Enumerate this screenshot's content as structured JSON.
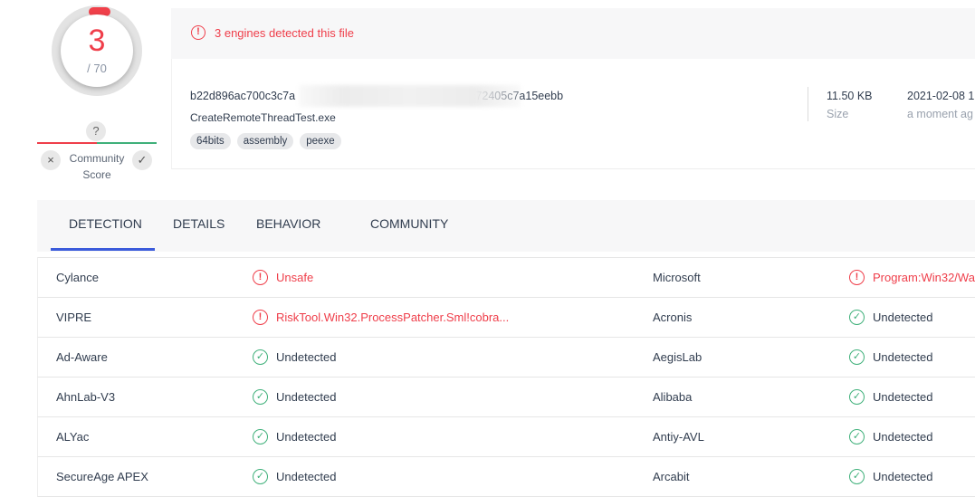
{
  "score": {
    "detected": "3",
    "total": "/ 70"
  },
  "community": {
    "question_icon": "?",
    "x_icon": "×",
    "check_icon": "✓",
    "label_line1": "Community",
    "label_line2": "Score"
  },
  "banner": {
    "icon": "!",
    "text": "3 engines detected this file"
  },
  "file": {
    "hash_visible": "b22d896ac700c3c7a                                        a0c08a9cc72405c7a15eebb",
    "name": "CreateRemoteThreadTest.exe",
    "tags": [
      "64bits",
      "assembly",
      "peexe"
    ],
    "size_value": "11.50 KB",
    "size_label": "Size",
    "date_value": "2021-02-08 1",
    "date_label": "a moment ag"
  },
  "tabs": [
    "DETECTION",
    "DETAILS",
    "BEHAVIOR",
    "COMMUNITY"
  ],
  "colors": {
    "malicious": "#ef3e4a",
    "clean": "#3fb07a",
    "accent": "#3b5bdb"
  },
  "detections": [
    {
      "left_engine": "Cylance",
      "left_result": "Unsafe",
      "left_status": "malicious",
      "right_engine": "Microsoft",
      "right_result": "Program:Win32/Wa",
      "right_status": "malicious"
    },
    {
      "left_engine": "VIPRE",
      "left_result": "RiskTool.Win32.ProcessPatcher.Sml!cobra...",
      "left_status": "malicious",
      "right_engine": "Acronis",
      "right_result": "Undetected",
      "right_status": "clean"
    },
    {
      "left_engine": "Ad-Aware",
      "left_result": "Undetected",
      "left_status": "clean",
      "right_engine": "AegisLab",
      "right_result": "Undetected",
      "right_status": "clean"
    },
    {
      "left_engine": "AhnLab-V3",
      "left_result": "Undetected",
      "left_status": "clean",
      "right_engine": "Alibaba",
      "right_result": "Undetected",
      "right_status": "clean"
    },
    {
      "left_engine": "ALYac",
      "left_result": "Undetected",
      "left_status": "clean",
      "right_engine": "Antiy-AVL",
      "right_result": "Undetected",
      "right_status": "clean"
    },
    {
      "left_engine": "SecureAge APEX",
      "left_result": "Undetected",
      "left_status": "clean",
      "right_engine": "Arcabit",
      "right_result": "Undetected",
      "right_status": "clean"
    }
  ]
}
